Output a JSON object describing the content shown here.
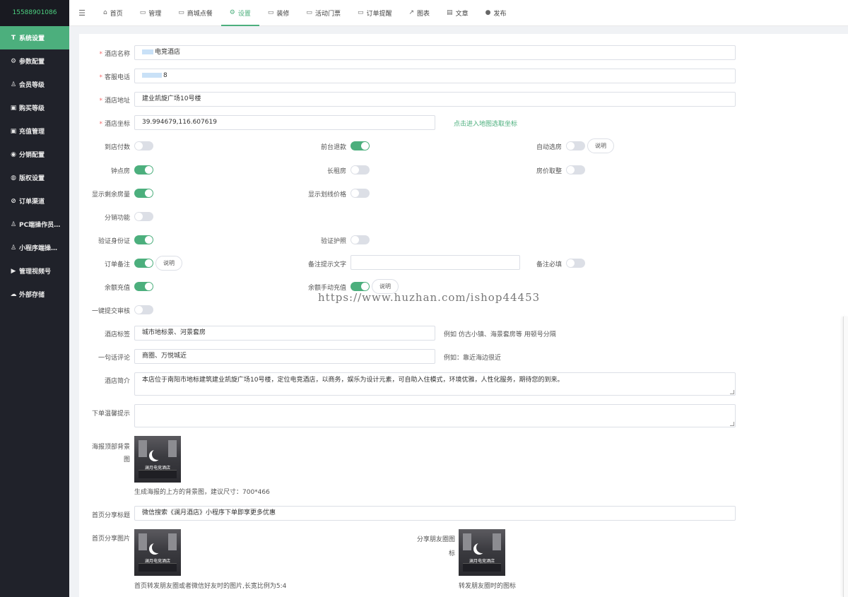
{
  "sidebar": {
    "phone": "15588901086",
    "items": [
      {
        "label": "系统设置",
        "icon": "T",
        "active": true
      },
      {
        "label": "参数配置",
        "icon": "⚙"
      },
      {
        "label": "会员等级",
        "icon": "♙"
      },
      {
        "label": "购买等级",
        "icon": "▣"
      },
      {
        "label": "充值管理",
        "icon": "▣"
      },
      {
        "label": "分销配置",
        "icon": "◉"
      },
      {
        "label": "版权设置",
        "icon": "◍"
      },
      {
        "label": "订单渠道",
        "icon": "⊘"
      },
      {
        "label": "PC端操作员…",
        "icon": "♙"
      },
      {
        "label": "小程序端操…",
        "icon": "♙"
      },
      {
        "label": "管理视频号",
        "icon": "▶"
      },
      {
        "label": "外部存储",
        "icon": "☁"
      }
    ]
  },
  "topnav": {
    "fold_icon": "☰",
    "tabs": [
      {
        "label": "首页",
        "icon": "⌂"
      },
      {
        "label": "管理",
        "icon": "▭"
      },
      {
        "label": "商城点餐",
        "icon": "▭"
      },
      {
        "label": "设置",
        "icon": "⚙",
        "active": true
      },
      {
        "label": "装修",
        "icon": "▭"
      },
      {
        "label": "活动门票",
        "icon": "▭"
      },
      {
        "label": "订单提醒",
        "icon": "▭"
      },
      {
        "label": "图表",
        "icon": "↗"
      },
      {
        "label": "文章",
        "icon": "▤"
      },
      {
        "label": "发布",
        "icon": "●"
      }
    ]
  },
  "form": {
    "hotel_name": {
      "label": "酒店名称",
      "value": "电竞酒店"
    },
    "service_phone": {
      "label": "客服电话",
      "value": "8"
    },
    "hotel_address": {
      "label": "酒店地址",
      "value": "建业凯旋广场10号楼"
    },
    "hotel_coord": {
      "label": "酒店坐标",
      "value": "39.994679,116.607619",
      "map_link": "点击进入地图选取坐标"
    },
    "switches": {
      "pay_at_store": {
        "label": "到店付数",
        "on": false
      },
      "front_refund": {
        "label": "前台退款",
        "on": true
      },
      "auto_room": {
        "label": "自动选房",
        "on": false,
        "help": "说明"
      },
      "hourly_room": {
        "label": "钟点房",
        "on": true
      },
      "long_rent": {
        "label": "长租房",
        "on": false
      },
      "price_round": {
        "label": "房价取整",
        "on": false
      },
      "show_remaining": {
        "label": "显示剩余房量",
        "on": true
      },
      "show_strike_price": {
        "label": "显示划线价格",
        "on": false
      },
      "distribution": {
        "label": "分销功能",
        "on": false
      },
      "verify_id": {
        "label": "验证身份证",
        "on": true
      },
      "verify_passport": {
        "label": "验证护照",
        "on": false
      },
      "order_remark": {
        "label": "订单备注",
        "on": true,
        "help": "说明"
      },
      "remark_required": {
        "label": "备注必填",
        "on": false
      },
      "balance_recharge": {
        "label": "余额充值",
        "on": true
      },
      "manual_recharge": {
        "label": "余额手动充值",
        "on": true,
        "help": "说明"
      },
      "one_click_review": {
        "label": "一键提交审核",
        "on": false
      }
    },
    "remark_hint_text": {
      "label": "备注提示文字",
      "value": ""
    },
    "hotel_tags": {
      "label": "酒店标签",
      "value": "城市地标景、河景套房",
      "hint": "例如 仿古小镇、海景套房等 用顿号分隔"
    },
    "one_line_review": {
      "label": "一句话评论",
      "value": "商圈、万悦城近",
      "hint": "例如：靠近海边很近"
    },
    "hotel_intro": {
      "label": "酒店简介",
      "value": "本店位于南阳市地标建筑建业凯旋广场10号楼，定位电竞酒店，以商务，娱乐为设计元素，可自助入住模式，环境优雅，人性化服务，期待您的到来。"
    },
    "order_tips": {
      "label": "下单温馨提示",
      "value": ""
    },
    "poster_bg": {
      "label_1": "海报顶部背景",
      "label_2": "图",
      "caption": "澜月电竞酒店",
      "desc": "生成海报的上方的背景图，建议尺寸：700*466"
    },
    "share_title": {
      "label": "首页分享标题",
      "value": "微信搜索《澜月酒店》小程序下单即享更多优惠"
    },
    "share_image": {
      "label": "首页分享图片",
      "caption": "澜月电竞酒店",
      "desc": "首页转发朋友圈或者微信好友时的图片,长宽比例为5:4"
    },
    "moments_icon": {
      "label_1": "分享朋友圈图",
      "label_2": "标",
      "caption": "澜月电竞酒店",
      "desc": "转发朋友圈时的图标"
    }
  },
  "watermark": "https://www.huzhan.com/ishop44453",
  "colors": {
    "accent": "#4caf7d",
    "sidebar_bg": "#20222a",
    "required": "#f56c6c"
  }
}
